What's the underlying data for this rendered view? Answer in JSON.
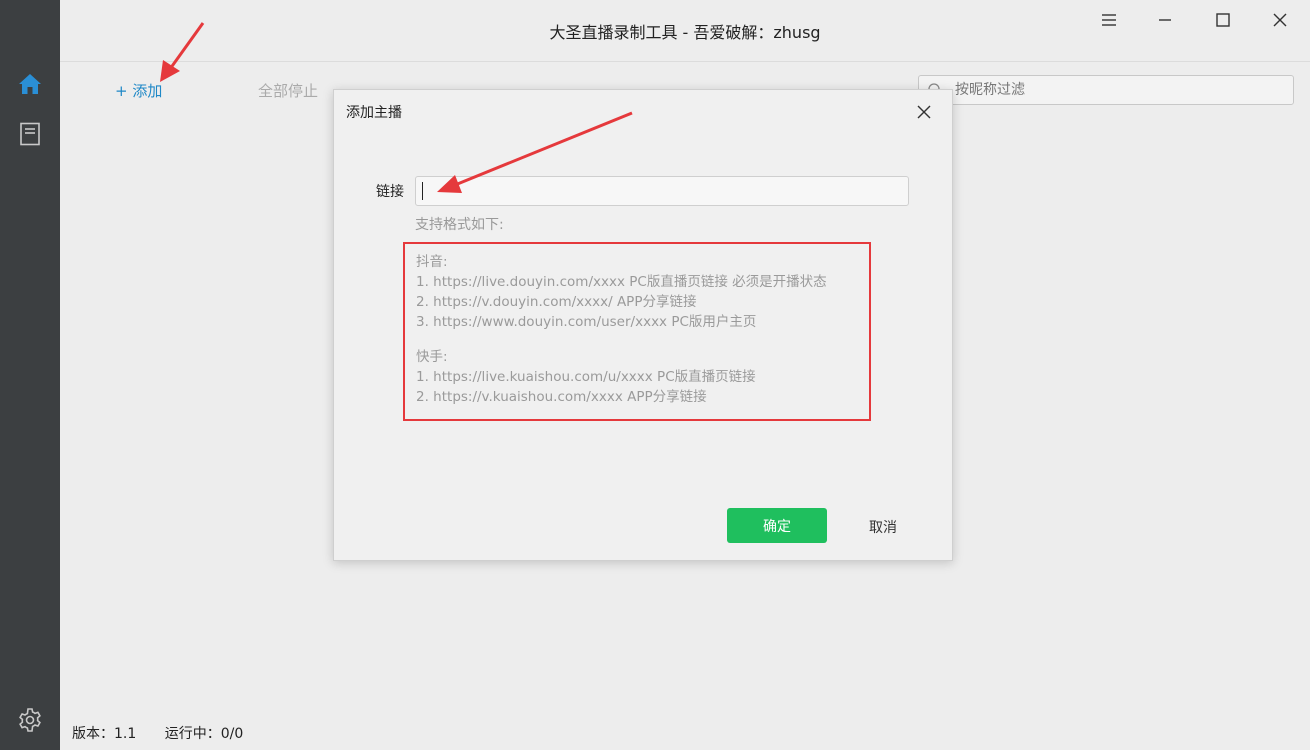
{
  "window": {
    "title": "大圣直播录制工具 - 吾爱破解：zhusg"
  },
  "toolbar": {
    "add_label": "+ 添加",
    "stop_all_label": "全部停止",
    "filter_placeholder": "按昵称过滤"
  },
  "statusbar": {
    "version": "版本：1.1",
    "running": "运行中：0/0"
  },
  "dialog": {
    "title": "添加主播",
    "link_label": "链接",
    "link_value": "",
    "formats_label": "支持格式如下:",
    "formats": {
      "douyin_header": "抖音:",
      "douyin_1": "1. https://live.douyin.com/xxxx PC版直播页链接 必须是开播状态",
      "douyin_2": "2. https://v.douyin.com/xxxx/ APP分享链接",
      "douyin_3": "3. https://www.douyin.com/user/xxxx PC版用户主页",
      "kuaishou_header": "快手:",
      "kuaishou_1": "1. https://live.kuaishou.com/u/xxxx PC版直播页链接",
      "kuaishou_2": "2. https://v.kuaishou.com/xxxx APP分享链接"
    },
    "ok_label": "确定",
    "cancel_label": "取消"
  },
  "colors": {
    "accent_blue": "#1e88c7",
    "ok_green": "#1fbf5e",
    "highlight_red": "#e5393c",
    "sidebar_bg": "#3c3f41"
  },
  "icons": {
    "sidebar": [
      "home-icon",
      "document-icon",
      "gear-icon"
    ],
    "window": [
      "menu-icon",
      "minimize-icon",
      "maximize-icon",
      "close-icon"
    ]
  }
}
